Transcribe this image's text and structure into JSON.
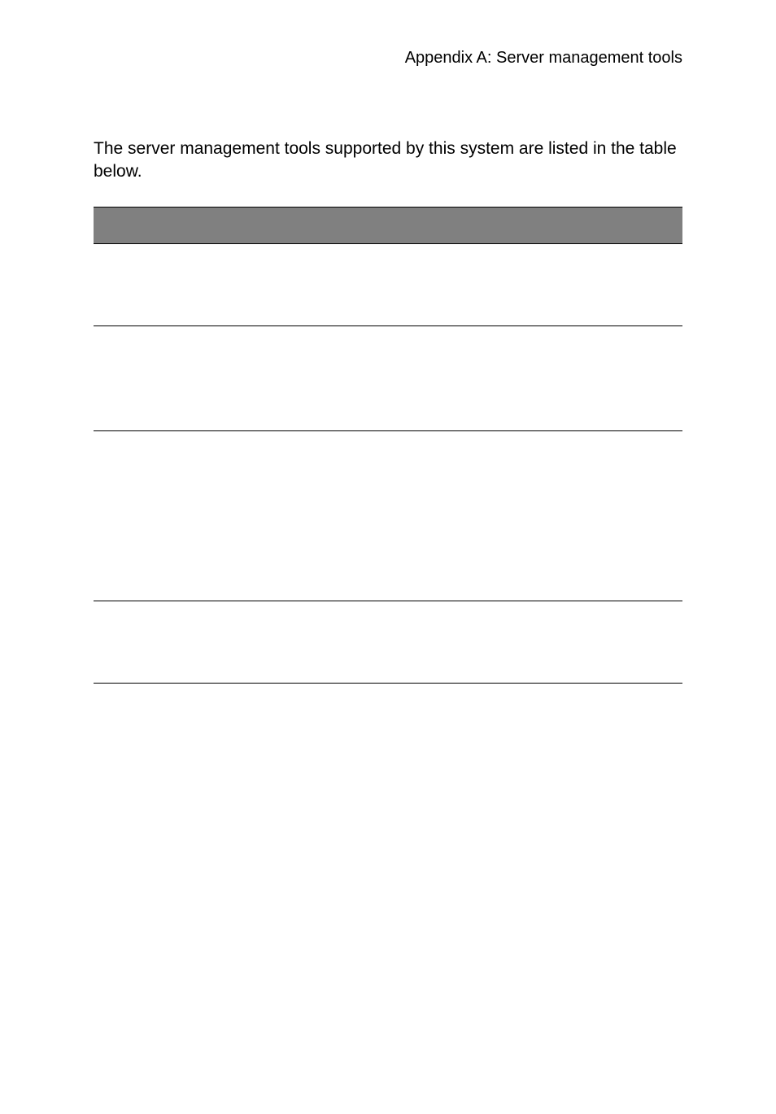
{
  "header": {
    "running_head": "Appendix A: Server management tools"
  },
  "body": {
    "intro": "The server management tools supported by this system are listed in the table below."
  },
  "table": {
    "header_cells": [
      "",
      ""
    ],
    "rows": [
      {
        "cells": [
          "",
          ""
        ]
      },
      {
        "cells": [
          "",
          ""
        ]
      },
      {
        "cells": [
          "",
          ""
        ]
      },
      {
        "cells": [
          "",
          ""
        ]
      }
    ]
  }
}
